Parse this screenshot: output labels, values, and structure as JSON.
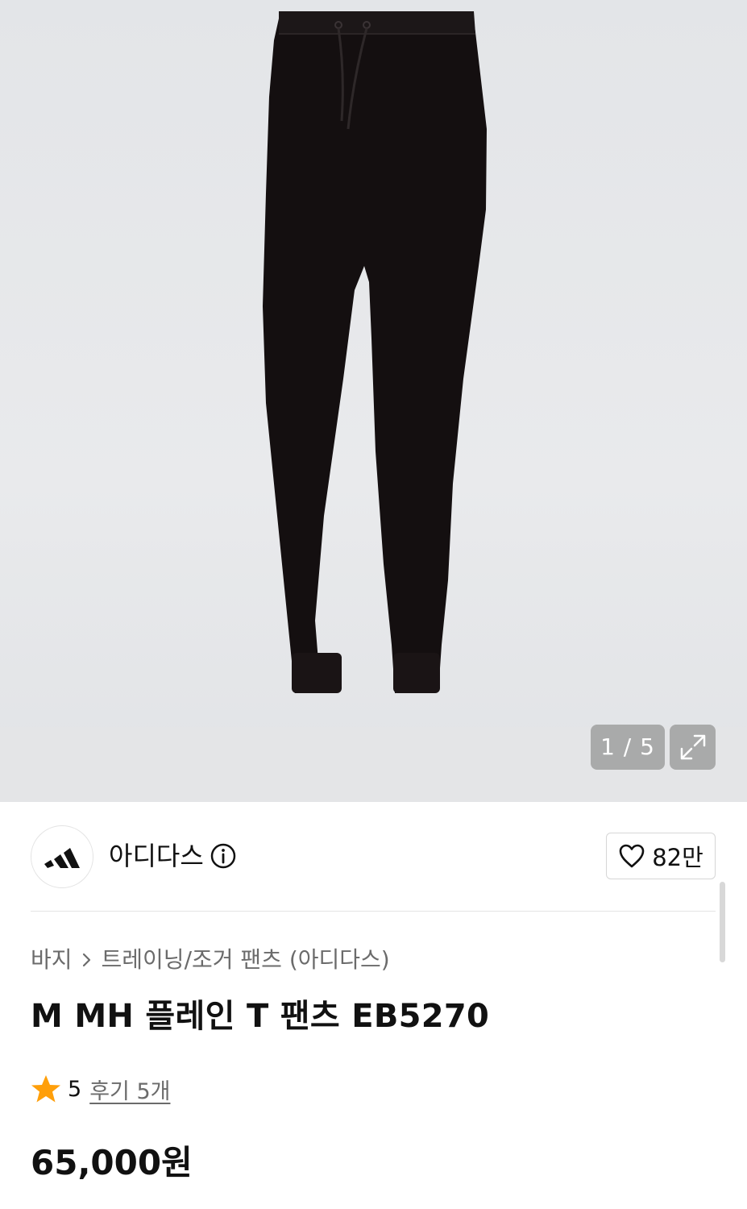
{
  "gallery": {
    "counter": "1 / 5",
    "expand_icon": "expand-arrows-icon"
  },
  "brand": {
    "name": "아디다스",
    "logo_icon": "adidas-logo",
    "info_icon": "info-circle-icon"
  },
  "like": {
    "icon": "heart-outline-icon",
    "count": "82만"
  },
  "breadcrumb": {
    "category": "바지",
    "separator_icon": "chevron-right-icon",
    "subcategory": "트레이닝/조거 팬츠 (아디다스)"
  },
  "product": {
    "title": "M MH 플레인 T 팬츠 EB5270",
    "rating": "5",
    "rating_icon": "star-icon",
    "review_link": "후기 5개",
    "price": "65,000원"
  },
  "colors": {
    "star": "#ff9f0a",
    "text": "#111111",
    "muted": "#6b6b6b"
  }
}
